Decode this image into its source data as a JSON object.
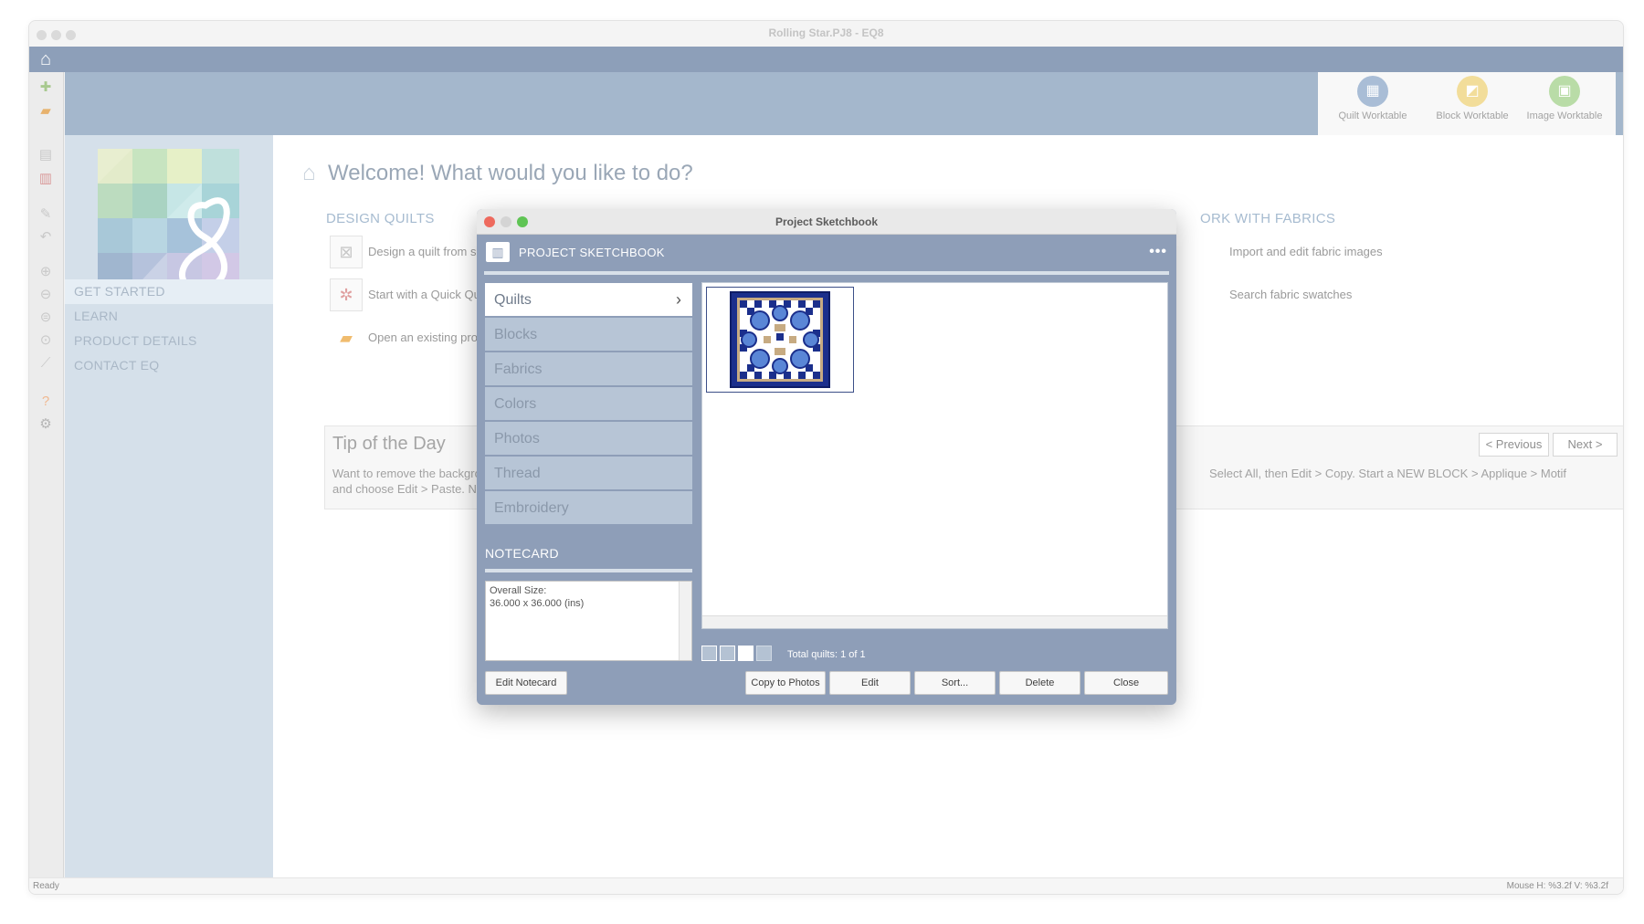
{
  "window": {
    "title": "Rolling Star.PJ8 - EQ8"
  },
  "worktables": [
    {
      "label": "Quilt Worktable",
      "icon": "quilt-worktable-icon",
      "color": "#a9bdd6"
    },
    {
      "label": "Block Worktable",
      "icon": "block-worktable-icon",
      "color": "#f2dd9a"
    },
    {
      "label": "Image Worktable",
      "icon": "image-worktable-icon",
      "color": "#b9dca7"
    }
  ],
  "sidebar": {
    "items": [
      {
        "label": "GET STARTED"
      },
      {
        "label": "LEARN"
      },
      {
        "label": "PRODUCT DETAILS"
      },
      {
        "label": "CONTACT EQ"
      }
    ]
  },
  "main": {
    "welcome": "Welcome! What would you like to do?",
    "design_title": "DESIGN QUILTS",
    "fabrics_title": "ORK WITH FABRICS",
    "design_actions": [
      {
        "label": "Design a quilt from scrat"
      },
      {
        "label": "Start with a Quick Quilt p"
      },
      {
        "label": "Open an existing project"
      }
    ],
    "fabric_actions": [
      {
        "label": "Import and edit fabric images"
      },
      {
        "label": "Search fabric swatches"
      }
    ],
    "tip": {
      "title": "Tip of the Day",
      "line1_left": "Want to remove the backgroun",
      "line1_right": "Select All, then Edit > Copy. Start a NEW BLOCK > Applique > Motif",
      "line2_left": "and choose Edit > Paste. Now",
      "prev_label": "< Previous",
      "next_label": "Next >"
    }
  },
  "status": {
    "left": "Ready",
    "right": "Mouse  H: %3.2f   V: %3.2f"
  },
  "dialog": {
    "title": "Project Sketchbook",
    "header": "PROJECT SKETCHBOOK",
    "more": "•••",
    "categories": [
      {
        "label": "Quilts",
        "active": true
      },
      {
        "label": "Blocks"
      },
      {
        "label": "Fabrics"
      },
      {
        "label": "Colors"
      },
      {
        "label": "Photos"
      },
      {
        "label": "Thread"
      },
      {
        "label": "Embroidery"
      }
    ],
    "notecard_label": "NOTECARD",
    "notecard_line1": "Overall Size:",
    "notecard_line2": "36.000 x 36.000 (ins)",
    "total": "Total quilts: 1 of 1",
    "buttons": {
      "edit_notecard": "Edit Notecard",
      "copy_to_photos": "Copy to Photos",
      "edit": "Edit",
      "sort": "Sort...",
      "delete": "Delete",
      "close": "Close"
    }
  },
  "colors": {
    "dialog_bg": "#8e9eb8",
    "quilt_navy": "#1b2f8c",
    "quilt_blue": "#5a86d6",
    "quilt_tan": "#c7ab82",
    "close_dot": "#ee6a5e",
    "min_dot": "#d4d4d4",
    "max_dot": "#5fc454"
  }
}
